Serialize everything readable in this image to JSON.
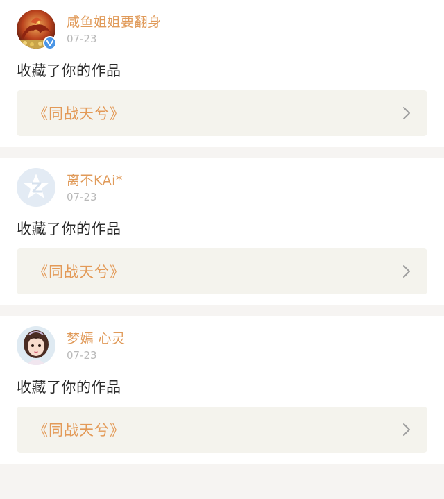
{
  "notifications": [
    {
      "username": "咸鱼姐姐要翻身",
      "date": "07-23",
      "action": "收藏了你的作品",
      "work_title": "《同战天兮》",
      "verified": true,
      "avatar": "dragon-avatar"
    },
    {
      "username": "离不KAi*",
      "date": "07-23",
      "action": "收藏了你的作品",
      "work_title": "《同战天兮》",
      "verified": false,
      "avatar": "default-z-avatar"
    },
    {
      "username": "梦嫣 心灵",
      "date": "07-23",
      "action": "收藏了你的作品",
      "work_title": "《同战天兮》",
      "verified": false,
      "avatar": "girl-avatar"
    }
  ],
  "icons": {
    "verify": "verified-v-icon",
    "chevron": "chevron-right-icon"
  },
  "colors": {
    "username": "#e09a59",
    "work_title": "#e39a58",
    "card_background": "#f4f3ed",
    "page_background": "#f6f4f2",
    "verify_badge": "#4a95e6"
  }
}
